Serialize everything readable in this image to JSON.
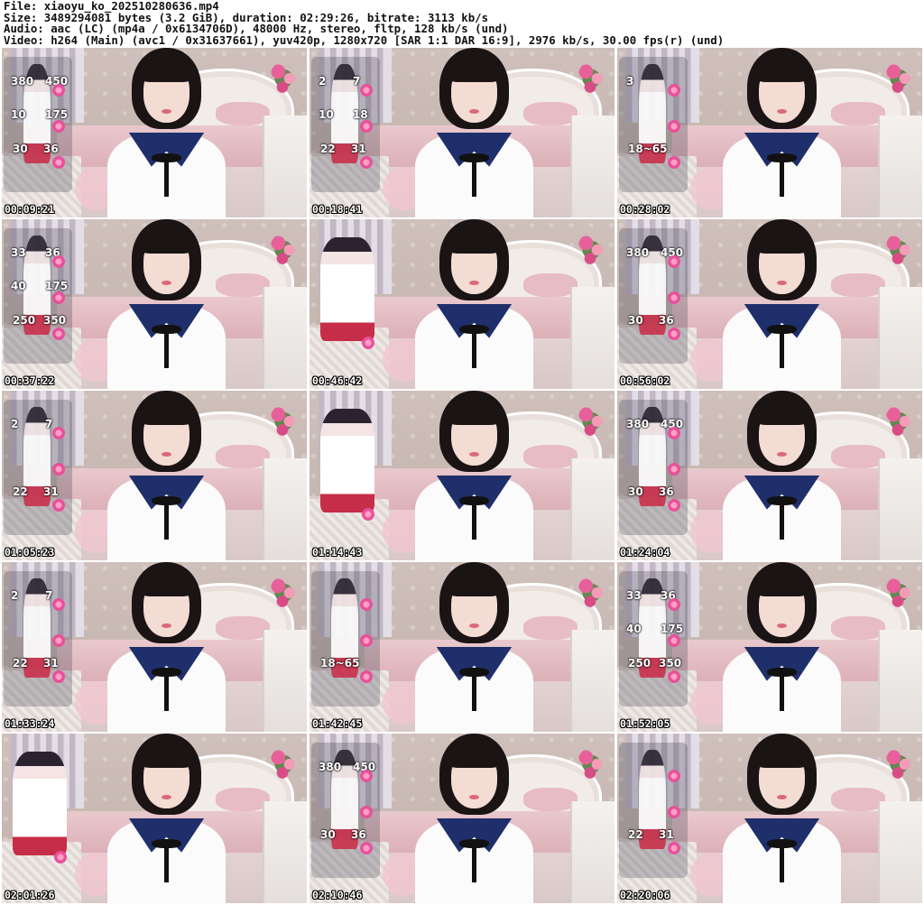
{
  "header": {
    "file_line": "File: xiaoyu_ko_202510280636.mp4",
    "size_line": "Size: 3489294081 bytes (3.2 GiB), duration: 02:29:26, bitrate: 3113 kb/s",
    "audio_line": "Audio: aac (LC) (mp4a / 0x6134706D), 48000 Hz, stereo, fltp, 128 kb/s (und)",
    "video_line": "Video: h264 (Main) (avc1 / 0x31637661), yuv420p, 1280x720 [SAR 1:1 DAR 16:9], 2976 kb/s, 30.00 fps(r) (und)"
  },
  "thumbnails": [
    {
      "timestamp": "00:09:21",
      "overlay": "stats",
      "nums": [
        "380",
        "450",
        "10",
        "175",
        "30",
        "36"
      ]
    },
    {
      "timestamp": "00:18:41",
      "overlay": "stats",
      "nums": [
        "2",
        "7",
        "10",
        "18",
        "22",
        "31"
      ]
    },
    {
      "timestamp": "00:28:02",
      "overlay": "stats",
      "nums": [
        "3",
        "",
        "",
        "",
        "18~65",
        ""
      ]
    },
    {
      "timestamp": "00:37:22",
      "overlay": "stats",
      "nums": [
        "33",
        "36",
        "40",
        "175",
        "250",
        "350"
      ]
    },
    {
      "timestamp": "00:46:42",
      "overlay": "avatar",
      "nums": []
    },
    {
      "timestamp": "00:56:02",
      "overlay": "stats",
      "nums": [
        "380",
        "450",
        "",
        "",
        "30",
        "36"
      ]
    },
    {
      "timestamp": "01:05:23",
      "overlay": "stats",
      "nums": [
        "2",
        "7",
        "",
        "",
        "22",
        "31"
      ]
    },
    {
      "timestamp": "01:14:43",
      "overlay": "avatar",
      "nums": []
    },
    {
      "timestamp": "01:24:04",
      "overlay": "stats",
      "nums": [
        "380",
        "450",
        "",
        "",
        "30",
        "36"
      ]
    },
    {
      "timestamp": "01:33:24",
      "overlay": "stats",
      "nums": [
        "2",
        "7",
        "",
        "",
        "22",
        "31"
      ]
    },
    {
      "timestamp": "01:42:45",
      "overlay": "stats",
      "nums": [
        "",
        "",
        "",
        "",
        "18~65",
        ""
      ]
    },
    {
      "timestamp": "01:52:05",
      "overlay": "stats",
      "nums": [
        "33",
        "36",
        "40",
        "175",
        "250",
        "350"
      ]
    },
    {
      "timestamp": "02:01:26",
      "overlay": "avatar",
      "nums": []
    },
    {
      "timestamp": "02:10:46",
      "overlay": "stats",
      "nums": [
        "380",
        "450",
        "",
        "",
        "30",
        "36"
      ]
    },
    {
      "timestamp": "02:20:06",
      "overlay": "stats",
      "nums": [
        "",
        "",
        "",
        "",
        "22",
        "31"
      ]
    }
  ]
}
